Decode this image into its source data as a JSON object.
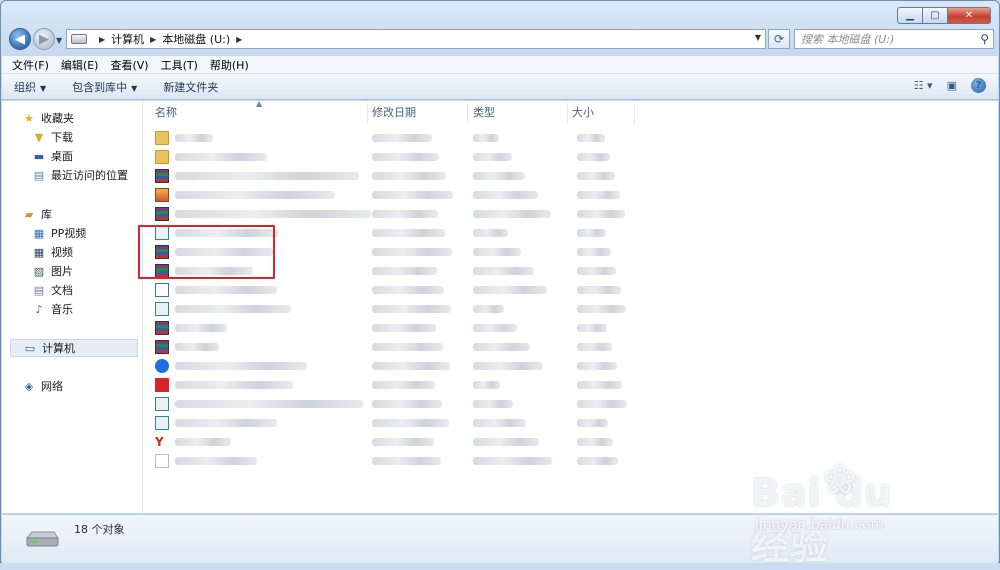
{
  "window": {
    "controls": {
      "minimize": "▁",
      "maximize": "▢",
      "close": "✕"
    }
  },
  "address": {
    "crumbs": [
      "计算机",
      "本地磁盘 (U:)"
    ],
    "search_placeholder": "搜索 本地磁盘 (U:)"
  },
  "menu": [
    "文件(F)",
    "编辑(E)",
    "查看(V)",
    "工具(T)",
    "帮助(H)"
  ],
  "commands": {
    "organize": "组织",
    "include_library": "包含到库中",
    "new_folder": "新建文件夹"
  },
  "nav": {
    "favorites": {
      "label": "收藏夹",
      "items": [
        "下载",
        "桌面",
        "最近访问的位置"
      ]
    },
    "libraries": {
      "label": "库",
      "items": [
        "PP视频",
        "视频",
        "图片",
        "文档",
        "音乐"
      ]
    },
    "computer": "计算机",
    "network": "网络"
  },
  "columns": {
    "name": "名称",
    "modified": "修改日期",
    "type": "类型",
    "size": "大小"
  },
  "file_icons": [
    "folder-icon",
    "folder-icon",
    "rar-icon",
    "image-icon",
    "rar-icon",
    "app-icon",
    "rar-icon",
    "rar-icon",
    "installer-icon",
    "app-icon",
    "rar-icon",
    "rar-icon",
    "browser-icon",
    "video-icon",
    "app-icon",
    "app-icon",
    "y-icon",
    "doc-icon"
  ],
  "status": {
    "count": "18 个对象"
  },
  "watermark": {
    "brand": "Bai  du 经验",
    "url": "jingyan.baidu.com"
  }
}
